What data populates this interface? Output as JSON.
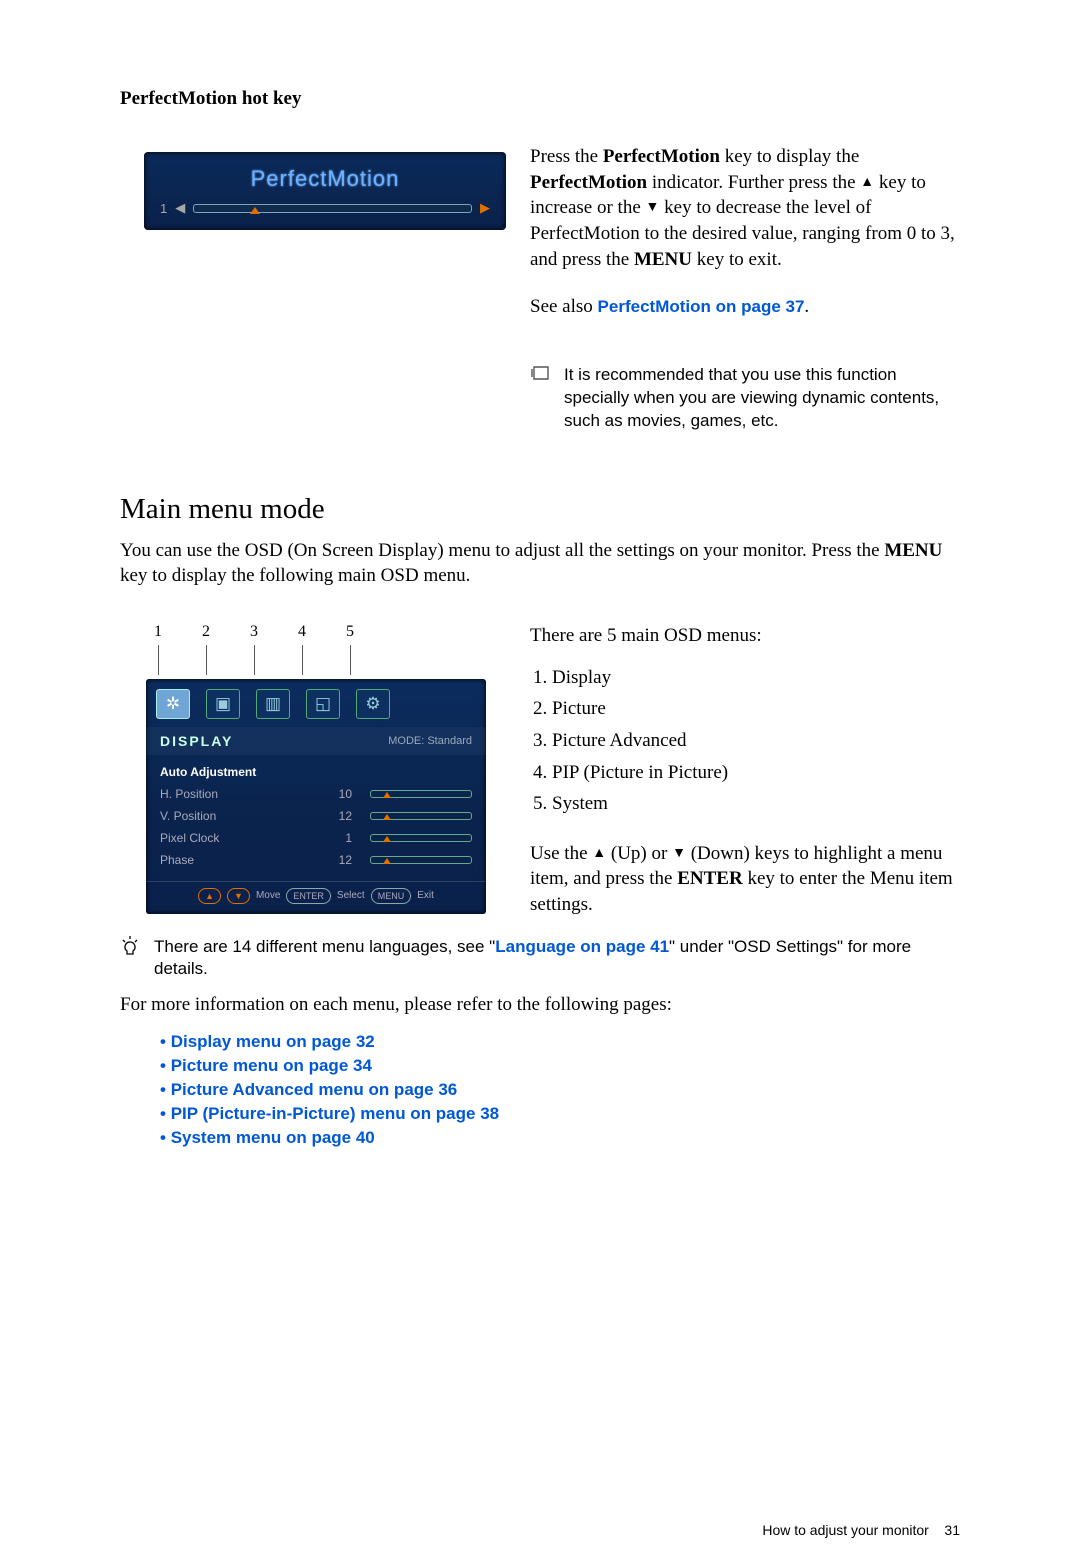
{
  "section1": {
    "title": "PerfectMotion hot key",
    "osd_label": "PerfectMotion",
    "osd_value": "1",
    "para_pre": "Press the ",
    "k1": "PerfectMotion",
    "para_mid1": " key to display the ",
    "k2": "PerfectMotion",
    "para_mid2": " indicator. Further press the ",
    "para_mid3": " key to increase or the ",
    "para_mid4": " key to decrease the level of PerfectMotion to the desired value, ranging from 0 to 3, and press the ",
    "k3": "MENU",
    "para_end": " key to exit.",
    "see_also_pre": "See also ",
    "see_also_link": "PerfectMotion on page 37",
    "see_also_post": ".",
    "note": "It is recommended that you use this function specially when you are viewing dynamic contents, such as movies, games, etc."
  },
  "section2": {
    "title": "Main menu mode",
    "intro": "You can use the OSD (On Screen Display) menu to adjust all the settings on your monitor. Press the ",
    "intro_key": "MENU",
    "intro_post": " key to display the following main OSD menu.",
    "label_numbers": [
      "1",
      "2",
      "3",
      "4",
      "5"
    ],
    "osd": {
      "panel_title": "DISPLAY",
      "mode_label": "MODE: Standard",
      "items": [
        {
          "name": "Auto Adjustment",
          "value": "",
          "slider": false
        },
        {
          "name": "H. Position",
          "value": "10",
          "slider": true
        },
        {
          "name": "V. Position",
          "value": "12",
          "slider": true
        },
        {
          "name": "Pixel Clock",
          "value": "1",
          "slider": true
        },
        {
          "name": "Phase",
          "value": "12",
          "slider": true
        }
      ],
      "footer": {
        "move": "Move",
        "select": "Select",
        "exit": "Exit",
        "enter": "ENTER",
        "menu": "MENU",
        "up": "▲",
        "down": "▼"
      }
    },
    "right_intro": "There are 5 main OSD menus:",
    "menus": [
      "Display",
      "Picture",
      "Picture Advanced",
      "PIP (Picture in Picture)",
      "System"
    ],
    "nav_pre": "Use the ",
    "nav_up": " (Up) or ",
    "nav_down": " (Down) keys to highlight a menu item, and press the ",
    "nav_key": "ENTER",
    "nav_post": " key to enter the Menu item settings.",
    "tip_pre": "There are 14 different menu languages, see \"",
    "tip_link": "Language on page 41",
    "tip_post": "\" under \"OSD Settings\" for more details.",
    "more_info": "For more information on each menu, please refer to the following pages:",
    "links": [
      "Display menu on page 32",
      "Picture menu on page 34",
      "Picture Advanced menu on page 36",
      "PIP (Picture-in-Picture) menu on page 38",
      "System menu on page 40"
    ]
  },
  "footer": {
    "text": "How to adjust your monitor",
    "page": "31"
  }
}
